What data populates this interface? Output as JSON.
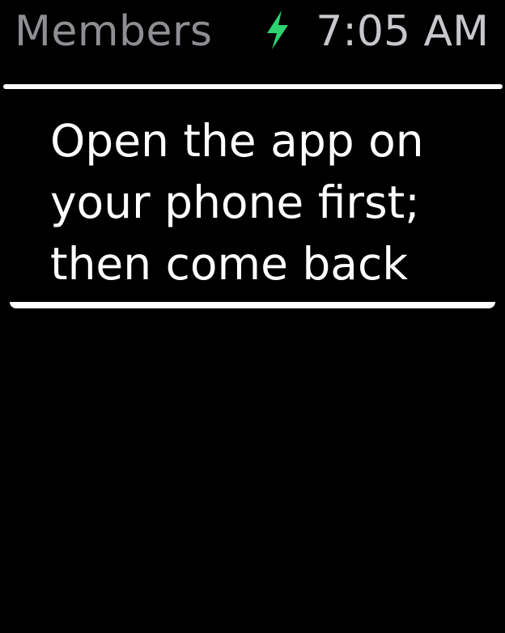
{
  "status_bar": {
    "title": "Members",
    "charging_icon": "lightning-bolt-icon",
    "time": "7:05 AM"
  },
  "message": {
    "text": "Open the app on\nyour phone first;\nthen come back"
  },
  "colors": {
    "background": "#000000",
    "title_text": "#8E8E93",
    "time_text": "#C7C7CC",
    "charging_accent": "#2DD36F",
    "message_text": "#FFFFFF",
    "divider": "#FFFFFF"
  }
}
